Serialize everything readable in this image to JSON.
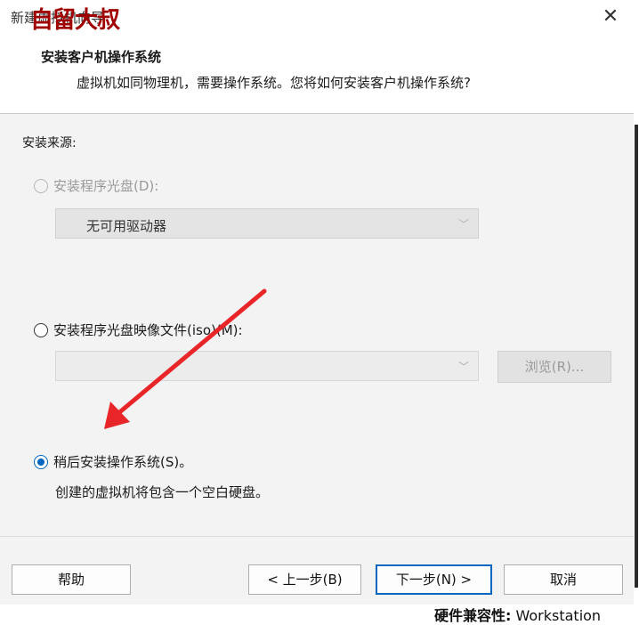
{
  "window": {
    "title": "新建虚拟机向导",
    "watermark": "自留大叔"
  },
  "header": {
    "heading": "安装客户机操作系统",
    "subheading": "虚拟机如同物理机，需要操作系统。您将如何安装客户机操作系统?"
  },
  "install_source": {
    "group_label": "安装来源:",
    "option_disc": {
      "label": "安装程序光盘(D):",
      "selected": false,
      "enabled": false
    },
    "drive_select": {
      "value": "无可用驱动器"
    },
    "option_iso": {
      "label": "安装程序光盘映像文件(iso)(M):",
      "selected": false,
      "enabled": true
    },
    "iso_path": {
      "value": ""
    },
    "browse_label": "浏览(R)...",
    "option_later": {
      "label": "稍后安装操作系统(S)。",
      "selected": true,
      "enabled": true
    },
    "later_description": "创建的虚拟机将包含一个空白硬盘。"
  },
  "footer": {
    "help": "帮助",
    "back": "< 上一步(B)",
    "next": "下一步(N) >",
    "cancel": "取消"
  },
  "background_text": {
    "bold": "硬件兼容性:",
    "rest": " Workstation"
  },
  "colors": {
    "accent": "#0067c0",
    "arrow": "#e8262a",
    "watermark": "#a00000"
  }
}
